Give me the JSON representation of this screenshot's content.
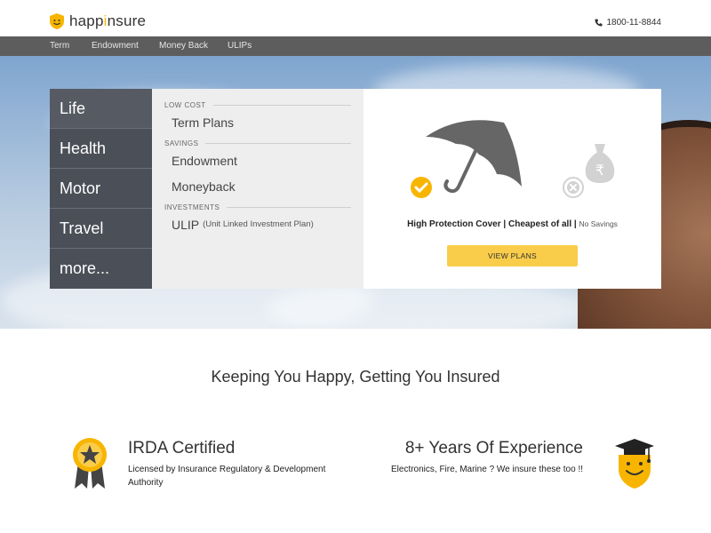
{
  "header": {
    "logo_prefix": "happ",
    "logo_i": "i",
    "logo_suffix": "nsure",
    "phone": "1800-11-8844",
    "phone_icon": "phone-icon",
    "logo_icon": "smiley-shield-icon"
  },
  "navbar": {
    "items": [
      "Term",
      "Endowment",
      "Money Back",
      "ULIPs"
    ]
  },
  "tabs": {
    "items": [
      "Life",
      "Health",
      "Motor",
      "Travel",
      "more..."
    ],
    "active": "Life"
  },
  "menu": {
    "sections": [
      {
        "category": "LOW COST",
        "items": [
          {
            "label": "Term Plans",
            "note": ""
          }
        ]
      },
      {
        "category": "SAVINGS",
        "items": [
          {
            "label": "Endowment",
            "note": ""
          },
          {
            "label": "Moneyback",
            "note": ""
          }
        ]
      },
      {
        "category": "INVESTMENTS",
        "items": [
          {
            "label": "ULIP",
            "note": "(Unit Linked Investment Plan)"
          }
        ]
      }
    ]
  },
  "panel": {
    "feature_bold": "High Protection Cover | Cheapest of all |",
    "feature_light": "No Savings",
    "button": "VIEW PLANS",
    "icons": [
      "umbrella-icon",
      "check-icon",
      "money-bag-icon",
      "cross-icon"
    ]
  },
  "tagline": "Keeping You Happy, Getting You Insured",
  "features": {
    "irda_title": "IRDA Certified",
    "irda_text": "Licensed by Insurance Regulatory & Development Authority",
    "experience_title": "8+ Years Of Experience",
    "experience_text": "Electronics, Fire, Marine ? We insure these too !!"
  },
  "colors": {
    "accent": "#f9cc4a",
    "nav_bg": "#5d5d5d",
    "tabs_bg": "#4b4f57"
  }
}
